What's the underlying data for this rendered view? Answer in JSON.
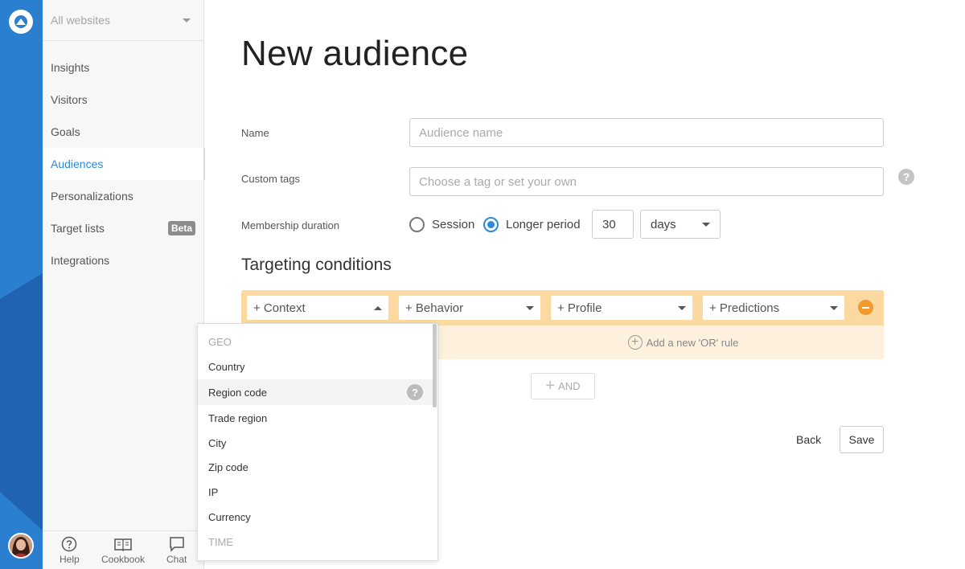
{
  "sidebar": {
    "site_selector": "All websites",
    "nav": [
      {
        "label": "Insights"
      },
      {
        "label": "Visitors"
      },
      {
        "label": "Goals"
      },
      {
        "label": "Audiences",
        "active": true
      },
      {
        "label": "Personalizations"
      },
      {
        "label": "Target lists",
        "badge": "Beta"
      },
      {
        "label": "Integrations"
      }
    ],
    "bottom": {
      "help": "Help",
      "cookbook": "Cookbook",
      "chat": "Chat"
    }
  },
  "page": {
    "title": "New audience",
    "name_label": "Name",
    "name_placeholder": "Audience name",
    "tags_label": "Custom tags",
    "tags_placeholder": "Choose a tag or set your own",
    "help_glyph": "?",
    "membership_label": "Membership duration",
    "session_label": "Session",
    "longer_period_label": "Longer period",
    "selected_duration": "longer_period",
    "duration_value": "30",
    "duration_unit": "days",
    "targeting_title": "Targeting conditions",
    "conditions": {
      "context": "+ Context",
      "behavior": "+ Behavior",
      "profile": "+ Profile",
      "predictions": "+ Predictions"
    },
    "add_or_rule": "Add a new 'OR' rule",
    "and_button": "AND",
    "back_button": "Back",
    "save_button": "Save"
  },
  "dropdown": {
    "items": [
      {
        "label": "GEO",
        "type": "header"
      },
      {
        "label": "Country"
      },
      {
        "label": "Region code",
        "hover": true,
        "help": true
      },
      {
        "label": "Trade region"
      },
      {
        "label": "City"
      },
      {
        "label": "Zip code"
      },
      {
        "label": "IP"
      },
      {
        "label": "Currency"
      },
      {
        "label": "TIME",
        "type": "header"
      }
    ]
  },
  "colors": {
    "rail": "#2a7fd0",
    "accent": "#2a8ad8",
    "condition_bar": "#fcd9a0",
    "or_area": "#fdf1dd",
    "remove": "#f39a2c"
  }
}
